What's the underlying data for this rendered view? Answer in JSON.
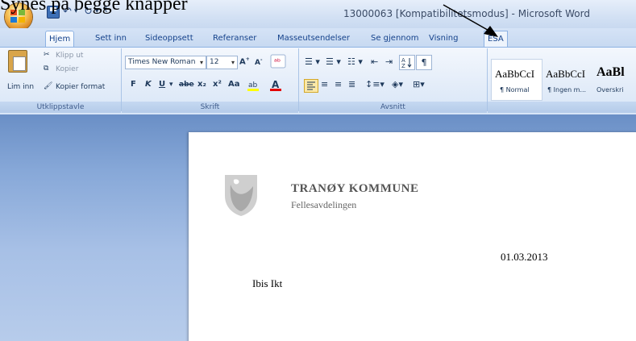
{
  "annotation": {
    "text": "Synes på begge knapper"
  },
  "window": {
    "title": "13000063 [Kompatibilitetsmodus] - Microsoft Word"
  },
  "quick_access": {
    "save_icon": "save-icon",
    "undo_icon": "undo-icon",
    "redo_icon": "redo-icon",
    "customize_icon": "customize-icon"
  },
  "tabs": [
    "Hjem",
    "Sett inn",
    "Sideoppsett",
    "Referanser",
    "Masseutsendelser",
    "Se gjennom",
    "Visning",
    "ESA"
  ],
  "active_tab": "Hjem",
  "ribbon": {
    "clipboard": {
      "paste": "Lim inn",
      "cut": "Klipp ut",
      "copy": "Kopier",
      "format_painter": "Kopier format",
      "label": "Utklippstavle"
    },
    "font": {
      "family": "Times New Roman",
      "size": "12",
      "bold": "F",
      "italic": "K",
      "underline": "U",
      "strike": "abe",
      "subscript": "x₂",
      "superscript": "x²",
      "change_case": "Aa",
      "label": "Skrift"
    },
    "paragraph": {
      "label": "Avsnitt"
    },
    "styles": {
      "items": [
        {
          "sample": "AaBbCcI",
          "name": "¶ Normal"
        },
        {
          "sample": "AaBbCcI",
          "name": "¶ Ingen m..."
        },
        {
          "sample": "AaBl",
          "name": "Overskri"
        }
      ]
    }
  },
  "document": {
    "company": "TRANØY KOMMUNE",
    "department": "Fellesavdelingen",
    "date": "01.03.2013",
    "addressee": "Ibis Ikt",
    "logo_icon": "municipal-shield-icon"
  },
  "colors": {
    "accent": "#15428b",
    "doc_bg": "#87a8d8"
  }
}
